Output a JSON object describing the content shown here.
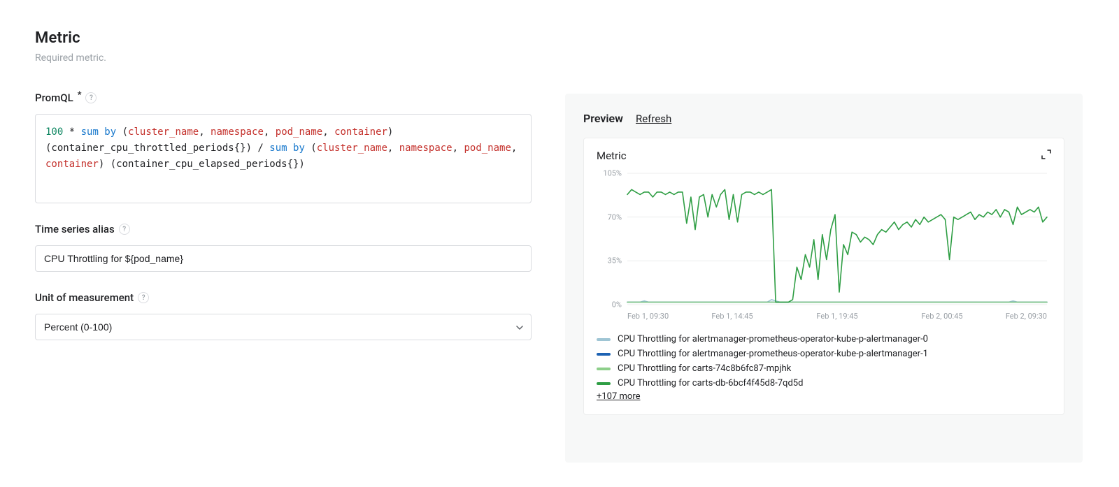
{
  "page": {
    "title": "Metric",
    "subtitle": "Required metric."
  },
  "promql": {
    "label": "PromQL",
    "required": "*",
    "tokens": [
      {
        "t": "num",
        "v": "100"
      },
      {
        "t": "txt",
        "v": " * "
      },
      {
        "t": "kw",
        "v": "sum by"
      },
      {
        "t": "txt",
        "v": " ("
      },
      {
        "t": "id",
        "v": "cluster_name"
      },
      {
        "t": "txt",
        "v": ", "
      },
      {
        "t": "id",
        "v": "namespace"
      },
      {
        "t": "txt",
        "v": ", "
      },
      {
        "t": "id",
        "v": "pod_name"
      },
      {
        "t": "txt",
        "v": ", "
      },
      {
        "t": "id",
        "v": "container"
      },
      {
        "t": "txt",
        "v": ") (container_cpu_throttled_periods{}) / "
      },
      {
        "t": "kw",
        "v": "sum by"
      },
      {
        "t": "txt",
        "v": " ("
      },
      {
        "t": "id",
        "v": "cluster_name"
      },
      {
        "t": "txt",
        "v": ", "
      },
      {
        "t": "id",
        "v": "namespace"
      },
      {
        "t": "txt",
        "v": ", "
      },
      {
        "t": "id",
        "v": "pod_name"
      },
      {
        "t": "txt",
        "v": ", "
      },
      {
        "t": "id",
        "v": "container"
      },
      {
        "t": "txt",
        "v": ") (container_cpu_elapsed_periods{})"
      }
    ]
  },
  "alias": {
    "label": "Time series alias",
    "value": "CPU Throttling for ${pod_name}"
  },
  "unit": {
    "label": "Unit of measurement",
    "value": "Percent (0-100)"
  },
  "preview": {
    "title": "Preview",
    "refresh": "Refresh",
    "chart_title": "Metric",
    "more": "+107 more"
  },
  "legend": [
    {
      "color": "#9fc5d4",
      "label": "CPU Throttling for alertmanager-prometheus-operator-kube-p-alertmanager-0"
    },
    {
      "color": "#1d62b3",
      "label": "CPU Throttling for alertmanager-prometheus-operator-kube-p-alertmanager-1"
    },
    {
      "color": "#8dcf8a",
      "label": "CPU Throttling for carts-74c8b6fc87-mpjhk"
    },
    {
      "color": "#2f9e44",
      "label": "CPU Throttling for carts-db-6bcf4f45d8-7qd5d"
    }
  ],
  "chart_data": {
    "type": "line",
    "title": "Metric",
    "xlabel": "",
    "ylabel": "",
    "ylim": [
      0,
      105
    ],
    "y_ticks": [
      "0%",
      "35%",
      "70%",
      "105%"
    ],
    "x_ticks": [
      "Feb 1, 09:30",
      "Feb 1, 14:45",
      "Feb 1, 19:45",
      "Feb 2, 00:45",
      "Feb 2, 09:30"
    ],
    "x": [
      0,
      1,
      2,
      3,
      4,
      5,
      6,
      7,
      8,
      9,
      10,
      11,
      12,
      13,
      14,
      15,
      16,
      17,
      18,
      19,
      20,
      21,
      22,
      23,
      24,
      25,
      26,
      27,
      28,
      29,
      30,
      31,
      32,
      33,
      34,
      35,
      36,
      37,
      38,
      39,
      40,
      41,
      42,
      43,
      44,
      45,
      46,
      47,
      48,
      49,
      50,
      51,
      52,
      53,
      54,
      55,
      56,
      57,
      58,
      59,
      60,
      61,
      62,
      63,
      64,
      65,
      66,
      67,
      68,
      69,
      70,
      71,
      72,
      73,
      74,
      75,
      76,
      77,
      78,
      79,
      80,
      81,
      82,
      83,
      84,
      85,
      86,
      87,
      88,
      89,
      90,
      91,
      92,
      93,
      94,
      95,
      96,
      97,
      98,
      99
    ],
    "series": [
      {
        "name": "CPU Throttling for alertmanager-prometheus-operator-kube-p-alertmanager-0",
        "color": "#9fc5d4",
        "values": [
          2,
          2,
          2,
          2,
          3,
          2,
          2,
          2,
          2,
          2,
          2,
          2,
          2,
          2,
          2,
          2,
          2,
          2,
          2,
          2,
          2,
          2,
          2,
          2,
          2,
          2,
          2,
          2,
          2,
          2,
          2,
          2,
          2,
          2,
          4,
          3,
          2,
          2,
          2,
          2,
          2,
          2,
          2,
          2,
          2,
          2,
          2,
          2,
          2,
          2,
          2,
          2,
          2,
          2,
          2,
          2,
          2,
          2,
          2,
          2,
          2,
          2,
          2,
          2,
          2,
          2,
          2,
          2,
          2,
          2,
          2,
          2,
          2,
          2,
          2,
          2,
          2,
          2,
          2,
          2,
          2,
          2,
          2,
          2,
          2,
          2,
          2,
          2,
          2,
          2,
          2,
          3,
          2,
          2,
          2,
          2,
          2,
          2,
          2,
          2
        ]
      },
      {
        "name": "CPU Throttling for alertmanager-prometheus-operator-kube-p-alertmanager-1",
        "color": "#1d62b3",
        "values": [
          2,
          2,
          2,
          2,
          2,
          2,
          2,
          2,
          2,
          2,
          2,
          2,
          2,
          2,
          2,
          2,
          2,
          2,
          2,
          2,
          2,
          2,
          2,
          2,
          2,
          2,
          2,
          2,
          2,
          2,
          2,
          2,
          2,
          2,
          2,
          2,
          2,
          2,
          2,
          2,
          2,
          2,
          2,
          2,
          2,
          2,
          2,
          2,
          2,
          2,
          2,
          2,
          2,
          2,
          2,
          2,
          2,
          2,
          2,
          2,
          2,
          2,
          2,
          2,
          2,
          2,
          2,
          2,
          2,
          2,
          2,
          2,
          2,
          2,
          2,
          2,
          2,
          2,
          2,
          2,
          2,
          2,
          2,
          2,
          2,
          2,
          2,
          2,
          2,
          2,
          2,
          2,
          2,
          2,
          2,
          2,
          2,
          2,
          2,
          2
        ]
      },
      {
        "name": "CPU Throttling for carts-74c8b6fc87-mpjhk",
        "color": "#8dcf8a",
        "values": [
          2,
          2,
          2,
          2,
          2,
          2,
          2,
          2,
          2,
          2,
          2,
          2,
          2,
          2,
          2,
          2,
          2,
          2,
          2,
          2,
          2,
          2,
          2,
          2,
          2,
          2,
          2,
          2,
          2,
          2,
          2,
          2,
          2,
          2,
          2,
          2,
          2,
          2,
          2,
          2,
          2,
          2,
          2,
          2,
          2,
          2,
          2,
          2,
          2,
          2,
          2,
          2,
          2,
          2,
          2,
          2,
          2,
          2,
          2,
          2,
          2,
          2,
          2,
          2,
          2,
          2,
          2,
          2,
          2,
          2,
          2,
          2,
          2,
          2,
          2,
          2,
          2,
          2,
          2,
          2,
          2,
          2,
          2,
          2,
          2,
          2,
          2,
          2,
          2,
          2,
          2,
          2,
          2,
          2,
          2,
          2,
          2,
          2,
          2,
          2
        ]
      },
      {
        "name": "CPU Throttling for carts-db-6bcf4f45d8-7qd5d",
        "color": "#2f9e44",
        "values": [
          88,
          92,
          90,
          88,
          90,
          90,
          86,
          90,
          90,
          88,
          90,
          88,
          90,
          90,
          65,
          86,
          60,
          86,
          88,
          70,
          88,
          78,
          88,
          92,
          68,
          88,
          66,
          88,
          90,
          90,
          88,
          90,
          88,
          90,
          92,
          2,
          2,
          2,
          2,
          4,
          30,
          20,
          40,
          30,
          52,
          20,
          56,
          36,
          60,
          72,
          10,
          48,
          40,
          58,
          56,
          50,
          54,
          52,
          48,
          56,
          60,
          58,
          62,
          66,
          60,
          64,
          66,
          62,
          68,
          64,
          70,
          66,
          68,
          70,
          72,
          68,
          36,
          70,
          68,
          70,
          72,
          74,
          68,
          72,
          70,
          74,
          72,
          76,
          70,
          76,
          74,
          64,
          78,
          72,
          74,
          76,
          74,
          78,
          66,
          70
        ]
      }
    ]
  }
}
